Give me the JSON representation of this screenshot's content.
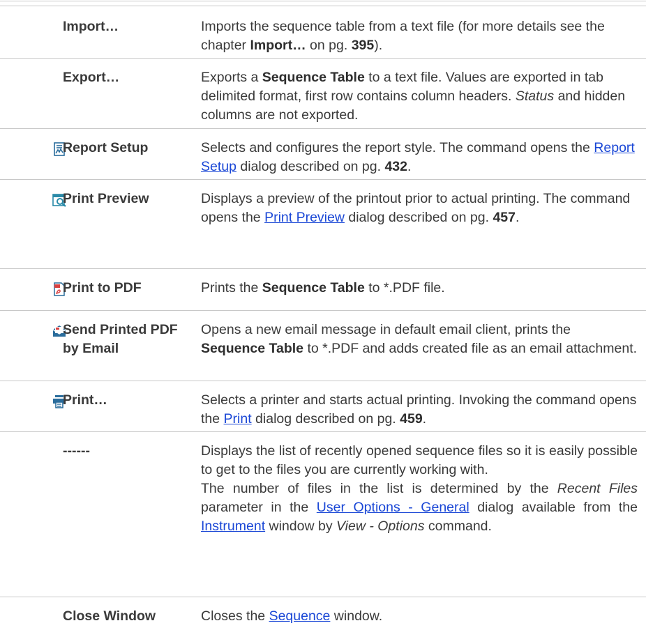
{
  "commands": [
    {
      "name": "Import…",
      "icon": null,
      "parts": [
        {
          "t": "Imports the sequence table from a text file (for more details see the chapter "
        },
        {
          "t": "Import…",
          "b": true
        },
        {
          "t": " on pg. "
        },
        {
          "t": "395",
          "b": true
        },
        {
          "t": ")."
        }
      ]
    },
    {
      "name": "Export…",
      "icon": null,
      "parts": [
        {
          "t": "Exports a "
        },
        {
          "t": "Sequence Table",
          "b": true
        },
        {
          "t": " to a text file. Values are exported in tab delimited format, first row contains column headers. "
        },
        {
          "t": "Status",
          "i": true
        },
        {
          "t": " and hidden columns are not exported."
        }
      ]
    },
    {
      "name": "Report Setup",
      "icon": "report-setup-icon",
      "parts": [
        {
          "t": "Selects and configures the report style. The command opens the "
        },
        {
          "t": "Report Setup",
          "link": true
        },
        {
          "t": " dialog described on pg. "
        },
        {
          "t": "432",
          "b": true
        },
        {
          "t": "."
        }
      ]
    },
    {
      "name": "Print Preview",
      "icon": "print-preview-icon",
      "parts": [
        {
          "t": "Displays a preview of the printout prior to actual printing. The command opens the "
        },
        {
          "t": "Print Preview",
          "link": true
        },
        {
          "t": " dialog described on pg. "
        },
        {
          "t": "457",
          "b": true
        },
        {
          "t": "."
        }
      ]
    },
    {
      "name": "Print to PDF",
      "icon": "pdf-icon",
      "parts": [
        {
          "t": "Prints the "
        },
        {
          "t": "Sequence Table",
          "b": true
        },
        {
          "t": " to *.PDF file."
        }
      ]
    },
    {
      "name": "Send Printed PDF by Email",
      "icon": "email-pdf-icon",
      "parts": [
        {
          "t": "Opens a new email message in default email client, prints the "
        },
        {
          "t": "Sequence Table",
          "b": true
        },
        {
          "t": " to *.PDF and adds created file as an email attachment."
        }
      ]
    },
    {
      "name": "Print…",
      "icon": "printer-icon",
      "parts": [
        {
          "t": "Selects a printer and starts actual printing. Invoking the command opens the "
        },
        {
          "t": "Print",
          "link": true
        },
        {
          "t": " dialog described on pg. "
        },
        {
          "t": "459",
          "b": true
        },
        {
          "t": "."
        }
      ]
    },
    {
      "name": "------",
      "icon": null,
      "justify": true,
      "parts": [
        {
          "t": "Displays the list of recently opened sequence files so it is easily possible to get to the files you are currently working with."
        },
        {
          "br": true
        },
        {
          "t": "The number of files in the list is determined by the "
        },
        {
          "t": "Recent Files",
          "i": true
        },
        {
          "t": " parameter in the "
        },
        {
          "t": "User Options - General",
          "link": true
        },
        {
          "t": " dialog available from the "
        },
        {
          "t": "Instrument",
          "link": true
        },
        {
          "t": " window by "
        },
        {
          "t": "View - Options",
          "i": true
        },
        {
          "t": " command."
        }
      ]
    },
    {
      "name": "Close Window",
      "icon": null,
      "parts": [
        {
          "t": "Closes the "
        },
        {
          "t": "Sequence",
          "link": true
        },
        {
          "t": " window."
        }
      ]
    }
  ]
}
